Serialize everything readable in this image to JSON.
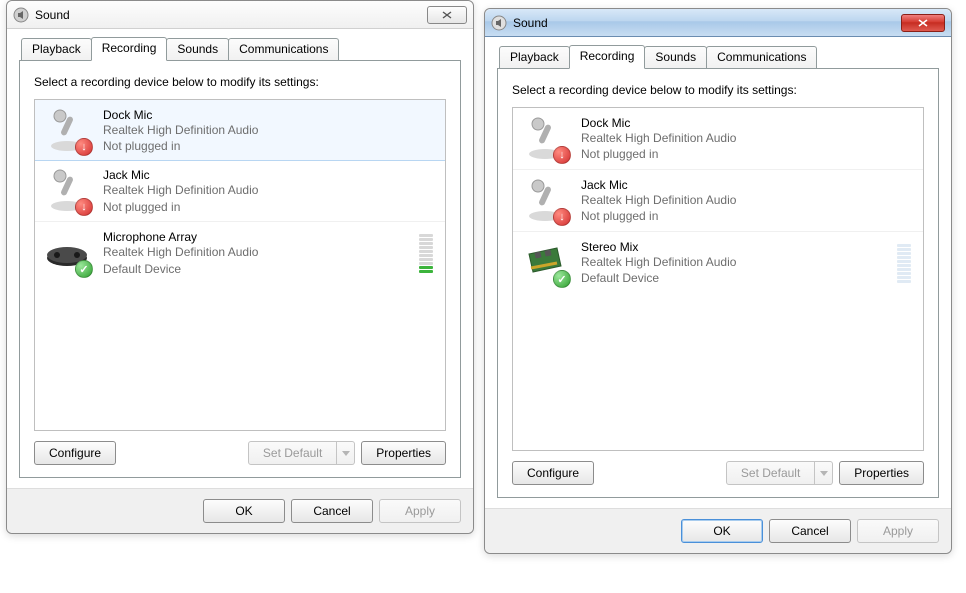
{
  "left": {
    "title": "Sound",
    "tabs": [
      "Playback",
      "Recording",
      "Sounds",
      "Communications"
    ],
    "active_tab": 1,
    "instruction": "Select a recording device below to modify its settings:",
    "devices": [
      {
        "name": "Dock Mic",
        "driver": "Realtek High Definition Audio",
        "status": "Not plugged in",
        "badge": "red",
        "icon": "mic"
      },
      {
        "name": "Jack Mic",
        "driver": "Realtek High Definition Audio",
        "status": "Not plugged in",
        "badge": "red",
        "icon": "mic"
      },
      {
        "name": "Microphone Array",
        "driver": "Realtek High Definition Audio",
        "status": "Default Device",
        "badge": "green",
        "icon": "array"
      }
    ],
    "list_height": 332,
    "selected_index": 0,
    "buttons": {
      "configure": "Configure",
      "set_default": "Set Default",
      "properties": "Properties"
    },
    "footer": {
      "ok": "OK",
      "cancel": "Cancel",
      "apply": "Apply"
    }
  },
  "right": {
    "title": "Sound",
    "tabs": [
      "Playback",
      "Recording",
      "Sounds",
      "Communications"
    ],
    "active_tab": 1,
    "instruction": "Select a recording device below to modify its settings:",
    "devices": [
      {
        "name": "Dock Mic",
        "driver": "Realtek High Definition Audio",
        "status": "Not plugged in",
        "badge": "red",
        "icon": "mic"
      },
      {
        "name": "Jack Mic",
        "driver": "Realtek High Definition Audio",
        "status": "Not plugged in",
        "badge": "red",
        "icon": "mic"
      },
      {
        "name": "Stereo Mix",
        "driver": "Realtek High Definition Audio",
        "status": "Default Device",
        "badge": "green",
        "icon": "card"
      }
    ],
    "list_height": 344,
    "selected_index": -1,
    "buttons": {
      "configure": "Configure",
      "set_default": "Set Default",
      "properties": "Properties"
    },
    "footer": {
      "ok": "OK",
      "cancel": "Cancel",
      "apply": "Apply"
    }
  }
}
